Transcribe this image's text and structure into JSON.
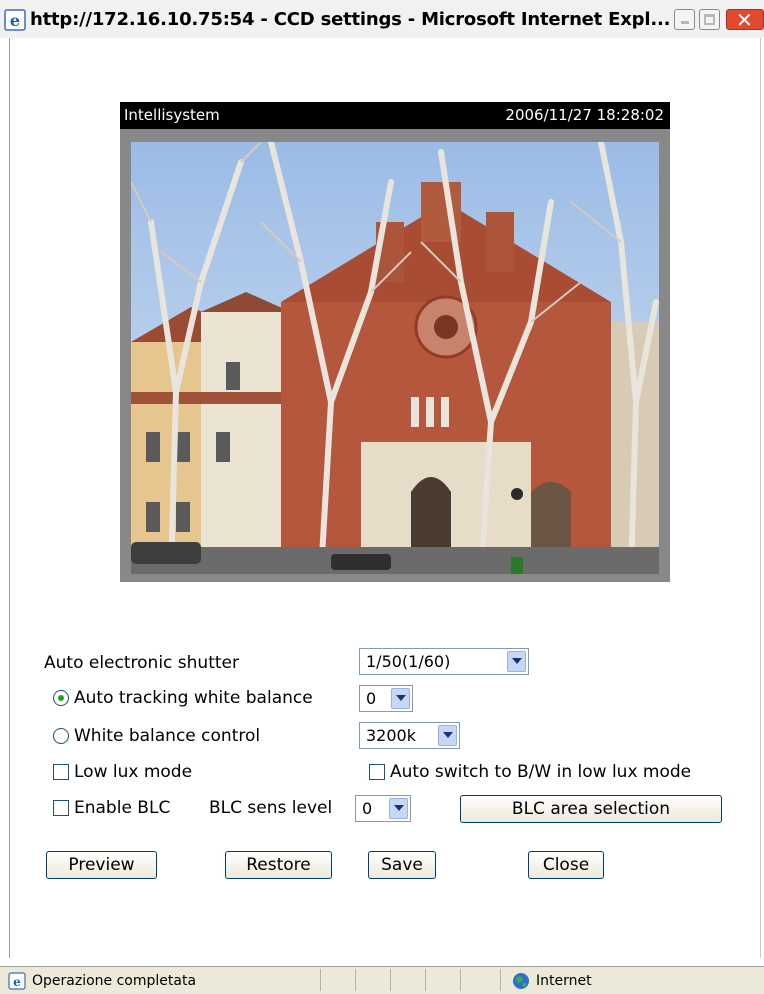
{
  "window": {
    "title": "http://172.16.10.75:54 - CCD settings - Microsoft Internet Expl...",
    "close_glyph": "✕"
  },
  "video": {
    "name": "Intellisystem",
    "timestamp": "2006/11/27 18:28:02"
  },
  "settings": {
    "shutter_label": "Auto electronic shutter",
    "shutter_value": "1/50(1/60)",
    "auto_wb_label": "Auto tracking white balance",
    "auto_wb_value": "0",
    "auto_wb_selected": true,
    "wb_control_label": "White balance control",
    "wb_control_value": "3200k",
    "low_lux_label": "Low lux mode",
    "low_lux_checked": false,
    "auto_bw_label": "Auto switch to B/W in low lux mode",
    "auto_bw_checked": false,
    "enable_blc_label": "Enable BLC",
    "enable_blc_checked": false,
    "blc_sens_label": "BLC sens level",
    "blc_sens_value": "0",
    "blc_area_label": "BLC area selection"
  },
  "buttons": {
    "preview": "Preview",
    "restore": "Restore",
    "save": "Save",
    "close": "Close"
  },
  "statusbar": {
    "status": "Operazione completata",
    "zone": "Internet"
  },
  "colors": {
    "selected_radio": "#21a121",
    "title_close": "#e24a30"
  }
}
